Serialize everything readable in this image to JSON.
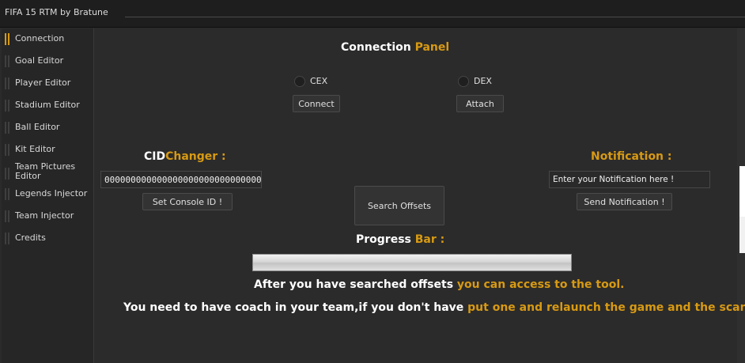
{
  "window": {
    "title": "FIFA 15 RTM by Bratune"
  },
  "sidebar": {
    "items": [
      {
        "label": "Connection",
        "active": true
      },
      {
        "label": "Goal Editor",
        "active": false
      },
      {
        "label": "Player Editor",
        "active": false
      },
      {
        "label": "Stadium Editor",
        "active": false
      },
      {
        "label": "Ball Editor",
        "active": false
      },
      {
        "label": "Kit Editor",
        "active": false
      },
      {
        "label": "Team Pictures\nEditor",
        "active": false
      },
      {
        "label": "Legends Injector",
        "active": false
      },
      {
        "label": "Team Injector",
        "active": false
      },
      {
        "label": "Credits",
        "active": false
      }
    ]
  },
  "connection_panel": {
    "heading_white": "Connection",
    "heading_gold": "Panel",
    "cex_label": "CEX",
    "dex_label": "DEX",
    "connect_button": "Connect",
    "attach_button": "Attach"
  },
  "cid_changer": {
    "heading_white": "CID",
    "heading_gold": "Changer :",
    "value": "000000000000000000000000000000000",
    "set_button": "Set Console ID !"
  },
  "search": {
    "button": "Search Offsets"
  },
  "notification": {
    "heading": "Notification :",
    "placeholder": "Enter your Notification here !",
    "send_button": "Send Notification !"
  },
  "progress": {
    "label_white": "Progress",
    "label_gold": "Bar :",
    "value": 1.0
  },
  "messages": {
    "line1_white": "After you have searched offsets",
    "line1_gold": "you can access to the tool.",
    "line2_white": "You need to have coach in your team,if you don't have",
    "line2_gold": "put one and relaunch the game and the scan."
  },
  "colors": {
    "accent": "#d89a13",
    "background": "#2b2b2b",
    "sidebar": "#262626"
  }
}
